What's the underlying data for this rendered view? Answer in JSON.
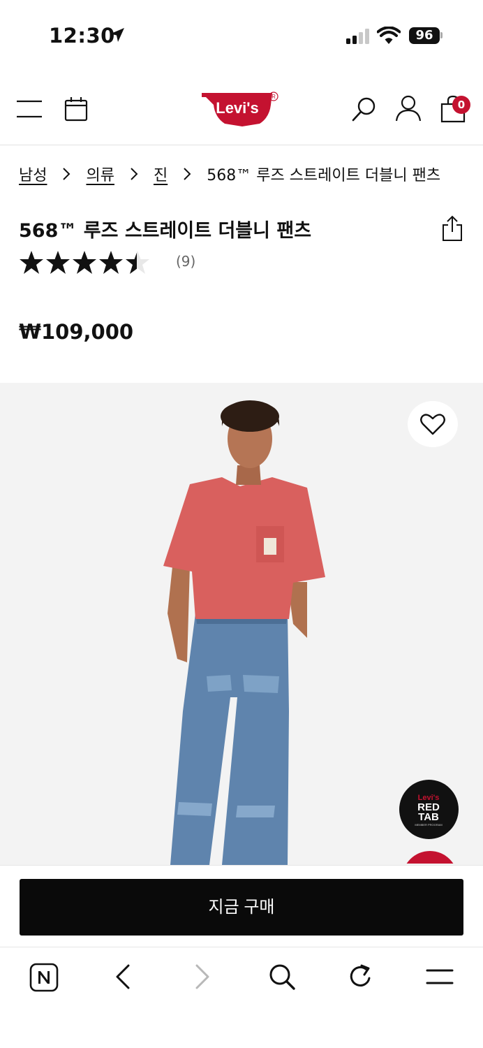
{
  "status_bar": {
    "time": "12:30",
    "battery": "96"
  },
  "header": {
    "logo_text": "Levi's",
    "cart_count": "0",
    "brand_red": "#c41230"
  },
  "breadcrumb": {
    "items": [
      "남성",
      "의류",
      "진"
    ],
    "current": "568™ 루즈 스트레이트 더블니 팬츠"
  },
  "product": {
    "title": "568™ 루즈 스트레이트 더블니 팬츠",
    "rating": 4.5,
    "rating_max": 5,
    "review_count": "(9)",
    "price": "₩109,000"
  },
  "badges": {
    "redtab_line1": "Levi's",
    "redtab_line2": "RED",
    "redtab_line3": "TAB",
    "redtab_line4": "MEMBER PROGRAM"
  },
  "buy_bar": {
    "buy_label": "지금 구매"
  },
  "browser_toolbar": {
    "items": [
      "naver-home-icon",
      "back-icon",
      "forward-icon",
      "search-icon",
      "reload-icon",
      "menu-icon"
    ]
  }
}
